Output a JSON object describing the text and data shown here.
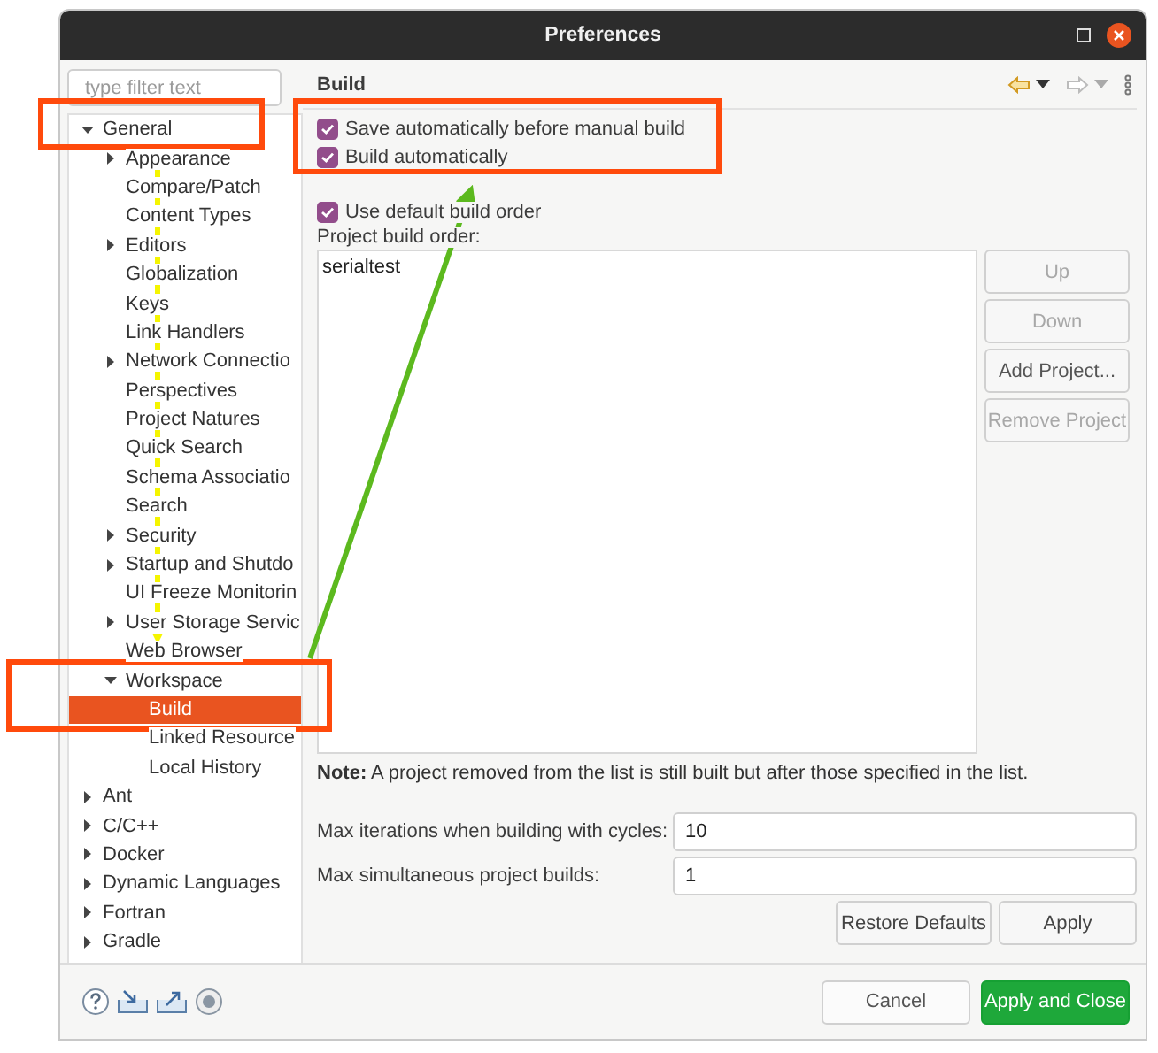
{
  "window": {
    "title": "Preferences"
  },
  "filter": {
    "placeholder": "type filter text"
  },
  "tree": [
    {
      "label": "General",
      "expanded": true,
      "selected": false,
      "children": [
        {
          "label": "Appearance",
          "expanded": false,
          "selected": false
        },
        {
          "label": "Compare/Patch",
          "selected": false
        },
        {
          "label": "Content Types",
          "selected": false
        },
        {
          "label": "Editors",
          "expanded": false,
          "selected": false
        },
        {
          "label": "Globalization",
          "selected": false
        },
        {
          "label": "Keys",
          "selected": false
        },
        {
          "label": "Link Handlers",
          "selected": false
        },
        {
          "label": "Network Connectio",
          "expanded": false,
          "selected": false
        },
        {
          "label": "Perspectives",
          "selected": false
        },
        {
          "label": "Project Natures",
          "selected": false
        },
        {
          "label": "Quick Search",
          "selected": false
        },
        {
          "label": "Schema Associatio",
          "selected": false
        },
        {
          "label": "Search",
          "selected": false
        },
        {
          "label": "Security",
          "expanded": false,
          "selected": false
        },
        {
          "label": "Startup and Shutdo",
          "expanded": false,
          "selected": false
        },
        {
          "label": "UI Freeze Monitorin",
          "selected": false
        },
        {
          "label": "User Storage Servic",
          "expanded": false,
          "selected": false
        },
        {
          "label": "Web Browser",
          "selected": false
        },
        {
          "label": "Workspace",
          "expanded": true,
          "selected": false,
          "children": [
            {
              "label": "Build",
              "selected": true
            },
            {
              "label": "Linked Resource",
              "selected": false
            },
            {
              "label": "Local History",
              "selected": false
            }
          ]
        }
      ]
    },
    {
      "label": "Ant",
      "expanded": false,
      "selected": false
    },
    {
      "label": "C/C++",
      "expanded": false,
      "selected": false
    },
    {
      "label": "Docker",
      "expanded": false,
      "selected": false
    },
    {
      "label": "Dynamic Languages",
      "expanded": false,
      "selected": false
    },
    {
      "label": "Fortran",
      "expanded": false,
      "selected": false
    },
    {
      "label": "Gradle",
      "expanded": false,
      "selected": false
    }
  ],
  "page": {
    "title": "Build",
    "top_options": [
      {
        "label": "Save automatically before manual build",
        "checked": true
      },
      {
        "label": "Build automatically",
        "checked": true
      }
    ],
    "default_order": {
      "label": "Use default build order",
      "checked": true
    },
    "order_label": "Project build order:",
    "projects": [
      "serialtest"
    ],
    "order_buttons": [
      {
        "label": "Up",
        "disabled": true
      },
      {
        "label": "Down",
        "disabled": true
      },
      {
        "label": "Add Project...",
        "disabled": false
      },
      {
        "label": "Remove Project",
        "disabled": true
      }
    ],
    "note": "**Note:** A project removed from the list is still built but after those specified in the list.",
    "fields": [
      {
        "label": "Max iterations when building with cycles:",
        "value": "10"
      },
      {
        "label": "Max simultaneous project builds:",
        "value": "1"
      }
    ],
    "buttons": [
      "Restore Defaults",
      "Apply"
    ]
  },
  "footer_buttons": [
    {
      "label": "Cancel",
      "primary": false
    },
    {
      "label": "Apply and Close",
      "primary": true
    }
  ]
}
